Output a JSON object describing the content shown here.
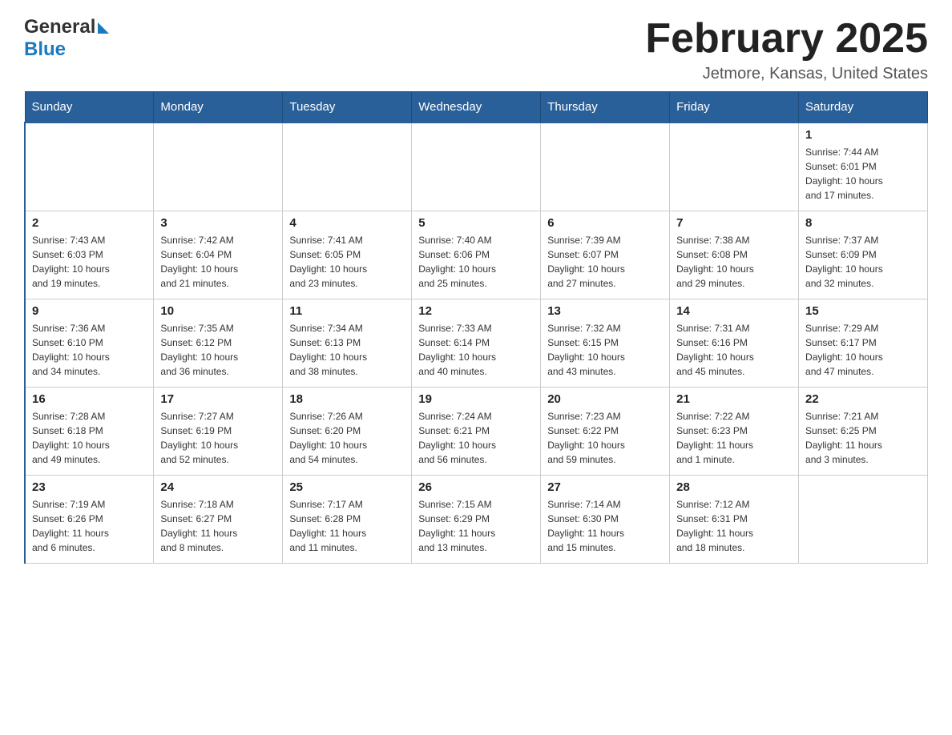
{
  "header": {
    "logo_general": "General",
    "logo_blue": "Blue",
    "month_title": "February 2025",
    "location": "Jetmore, Kansas, United States"
  },
  "days_of_week": [
    "Sunday",
    "Monday",
    "Tuesday",
    "Wednesday",
    "Thursday",
    "Friday",
    "Saturday"
  ],
  "weeks": [
    [
      {
        "day": "",
        "info": ""
      },
      {
        "day": "",
        "info": ""
      },
      {
        "day": "",
        "info": ""
      },
      {
        "day": "",
        "info": ""
      },
      {
        "day": "",
        "info": ""
      },
      {
        "day": "",
        "info": ""
      },
      {
        "day": "1",
        "info": "Sunrise: 7:44 AM\nSunset: 6:01 PM\nDaylight: 10 hours\nand 17 minutes."
      }
    ],
    [
      {
        "day": "2",
        "info": "Sunrise: 7:43 AM\nSunset: 6:03 PM\nDaylight: 10 hours\nand 19 minutes."
      },
      {
        "day": "3",
        "info": "Sunrise: 7:42 AM\nSunset: 6:04 PM\nDaylight: 10 hours\nand 21 minutes."
      },
      {
        "day": "4",
        "info": "Sunrise: 7:41 AM\nSunset: 6:05 PM\nDaylight: 10 hours\nand 23 minutes."
      },
      {
        "day": "5",
        "info": "Sunrise: 7:40 AM\nSunset: 6:06 PM\nDaylight: 10 hours\nand 25 minutes."
      },
      {
        "day": "6",
        "info": "Sunrise: 7:39 AM\nSunset: 6:07 PM\nDaylight: 10 hours\nand 27 minutes."
      },
      {
        "day": "7",
        "info": "Sunrise: 7:38 AM\nSunset: 6:08 PM\nDaylight: 10 hours\nand 29 minutes."
      },
      {
        "day": "8",
        "info": "Sunrise: 7:37 AM\nSunset: 6:09 PM\nDaylight: 10 hours\nand 32 minutes."
      }
    ],
    [
      {
        "day": "9",
        "info": "Sunrise: 7:36 AM\nSunset: 6:10 PM\nDaylight: 10 hours\nand 34 minutes."
      },
      {
        "day": "10",
        "info": "Sunrise: 7:35 AM\nSunset: 6:12 PM\nDaylight: 10 hours\nand 36 minutes."
      },
      {
        "day": "11",
        "info": "Sunrise: 7:34 AM\nSunset: 6:13 PM\nDaylight: 10 hours\nand 38 minutes."
      },
      {
        "day": "12",
        "info": "Sunrise: 7:33 AM\nSunset: 6:14 PM\nDaylight: 10 hours\nand 40 minutes."
      },
      {
        "day": "13",
        "info": "Sunrise: 7:32 AM\nSunset: 6:15 PM\nDaylight: 10 hours\nand 43 minutes."
      },
      {
        "day": "14",
        "info": "Sunrise: 7:31 AM\nSunset: 6:16 PM\nDaylight: 10 hours\nand 45 minutes."
      },
      {
        "day": "15",
        "info": "Sunrise: 7:29 AM\nSunset: 6:17 PM\nDaylight: 10 hours\nand 47 minutes."
      }
    ],
    [
      {
        "day": "16",
        "info": "Sunrise: 7:28 AM\nSunset: 6:18 PM\nDaylight: 10 hours\nand 49 minutes."
      },
      {
        "day": "17",
        "info": "Sunrise: 7:27 AM\nSunset: 6:19 PM\nDaylight: 10 hours\nand 52 minutes."
      },
      {
        "day": "18",
        "info": "Sunrise: 7:26 AM\nSunset: 6:20 PM\nDaylight: 10 hours\nand 54 minutes."
      },
      {
        "day": "19",
        "info": "Sunrise: 7:24 AM\nSunset: 6:21 PM\nDaylight: 10 hours\nand 56 minutes."
      },
      {
        "day": "20",
        "info": "Sunrise: 7:23 AM\nSunset: 6:22 PM\nDaylight: 10 hours\nand 59 minutes."
      },
      {
        "day": "21",
        "info": "Sunrise: 7:22 AM\nSunset: 6:23 PM\nDaylight: 11 hours\nand 1 minute."
      },
      {
        "day": "22",
        "info": "Sunrise: 7:21 AM\nSunset: 6:25 PM\nDaylight: 11 hours\nand 3 minutes."
      }
    ],
    [
      {
        "day": "23",
        "info": "Sunrise: 7:19 AM\nSunset: 6:26 PM\nDaylight: 11 hours\nand 6 minutes."
      },
      {
        "day": "24",
        "info": "Sunrise: 7:18 AM\nSunset: 6:27 PM\nDaylight: 11 hours\nand 8 minutes."
      },
      {
        "day": "25",
        "info": "Sunrise: 7:17 AM\nSunset: 6:28 PM\nDaylight: 11 hours\nand 11 minutes."
      },
      {
        "day": "26",
        "info": "Sunrise: 7:15 AM\nSunset: 6:29 PM\nDaylight: 11 hours\nand 13 minutes."
      },
      {
        "day": "27",
        "info": "Sunrise: 7:14 AM\nSunset: 6:30 PM\nDaylight: 11 hours\nand 15 minutes."
      },
      {
        "day": "28",
        "info": "Sunrise: 7:12 AM\nSunset: 6:31 PM\nDaylight: 11 hours\nand 18 minutes."
      },
      {
        "day": "",
        "info": ""
      }
    ]
  ]
}
